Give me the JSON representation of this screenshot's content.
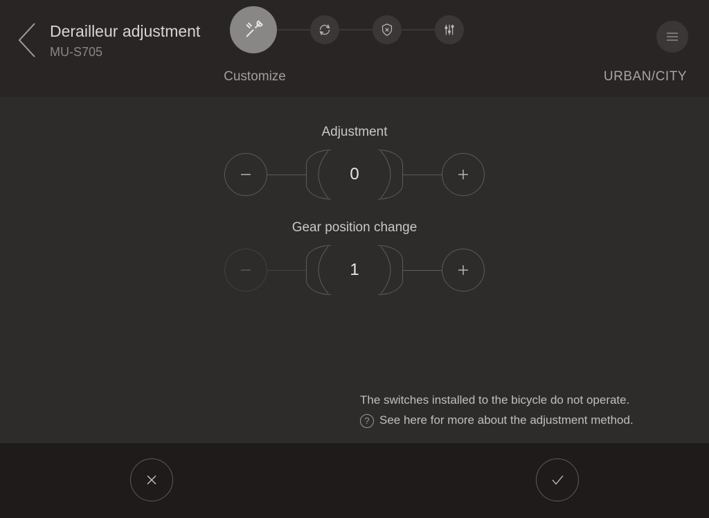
{
  "header": {
    "title": "Derailleur adjustment",
    "subtitle": "MU-S705",
    "step_label": "Customize",
    "mode": "URBAN/CITY"
  },
  "controls": {
    "adjustment": {
      "label": "Adjustment",
      "value": "0"
    },
    "gear": {
      "label": "Gear position change",
      "value": "1"
    }
  },
  "info": {
    "line1": "The switches installed to the bicycle do not operate.",
    "line2": "See here for more about the adjustment method."
  }
}
